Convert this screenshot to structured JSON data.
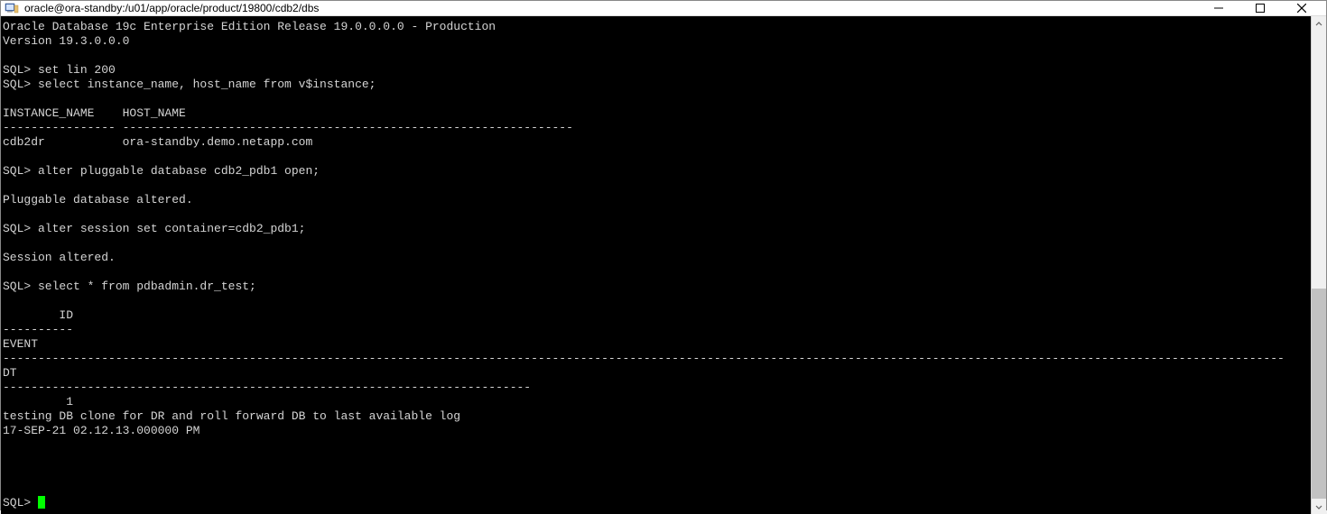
{
  "window": {
    "title": "oracle@ora-standby:/u01/app/oracle/product/19800/cdb2/dbs"
  },
  "terminal": {
    "lines": [
      "Oracle Database 19c Enterprise Edition Release 19.0.0.0.0 - Production",
      "Version 19.3.0.0.0",
      "",
      "SQL> set lin 200",
      "SQL> select instance_name, host_name from v$instance;",
      "",
      "INSTANCE_NAME    HOST_NAME",
      "---------------- ----------------------------------------------------------------",
      "cdb2dr           ora-standby.demo.netapp.com",
      "",
      "SQL> alter pluggable database cdb2_pdb1 open;",
      "",
      "Pluggable database altered.",
      "",
      "SQL> alter session set container=cdb2_pdb1;",
      "",
      "Session altered.",
      "",
      "SQL> select * from pdbadmin.dr_test;",
      "",
      "        ID",
      "----------",
      "EVENT",
      "--------------------------------------------------------------------------------------------------------------------------------------------------------------------------------------",
      "DT",
      "---------------------------------------------------------------------------",
      "         1",
      "testing DB clone for DR and roll forward DB to last available log",
      "17-SEP-21 02.12.13.000000 PM",
      "",
      "",
      "",
      ""
    ],
    "prompt": "SQL> "
  }
}
